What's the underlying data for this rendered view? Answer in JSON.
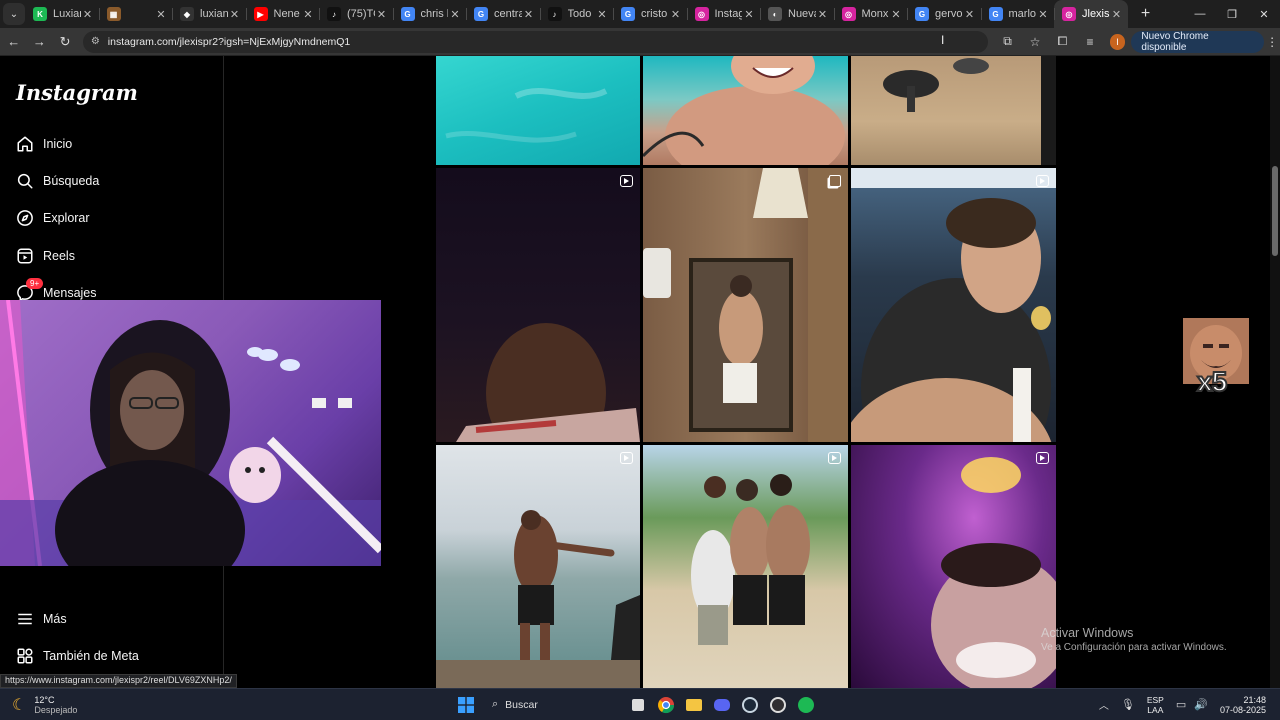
{
  "browser": {
    "tabs": [
      {
        "title": "Luxian",
        "favicon_color": "#1db954",
        "favicon_glyph": "K",
        "active": false
      },
      {
        "title": "",
        "favicon_color": "#8a5a2b",
        "favicon_glyph": "▦",
        "active": false
      },
      {
        "title": "luxiani",
        "favicon_color": "#333333",
        "favicon_glyph": "◆",
        "active": false
      },
      {
        "title": "Nene d",
        "favicon_color": "#ff0000",
        "favicon_glyph": "▶",
        "active": false
      },
      {
        "title": "(75)TOI",
        "favicon_color": "#111111",
        "favicon_glyph": "♪",
        "active": false
      },
      {
        "title": "chris h",
        "favicon_color": "#4285f4",
        "favicon_glyph": "G",
        "active": false
      },
      {
        "title": "central",
        "favicon_color": "#4285f4",
        "favicon_glyph": "G",
        "active": false
      },
      {
        "title": "Todo ki",
        "favicon_color": "#111111",
        "favicon_glyph": "♪",
        "active": false
      },
      {
        "title": "cristo r",
        "favicon_color": "#4285f4",
        "favicon_glyph": "G",
        "active": false
      },
      {
        "title": "Instagr",
        "favicon_color": "#d6249f",
        "favicon_glyph": "◎",
        "active": false
      },
      {
        "title": "Nueva",
        "favicon_color": "#555555",
        "favicon_glyph": "◐",
        "active": false
      },
      {
        "title": "Monxi",
        "favicon_color": "#d6249f",
        "favicon_glyph": "◎",
        "active": false
      },
      {
        "title": "gervon",
        "favicon_color": "#4285f4",
        "favicon_glyph": "G",
        "active": false
      },
      {
        "title": "marlon",
        "favicon_color": "#4285f4",
        "favicon_glyph": "G",
        "active": false
      },
      {
        "title": "Jlexispr",
        "favicon_color": "#d6249f",
        "favicon_glyph": "◎",
        "active": true
      }
    ],
    "url": "instagram.com/jlexispr2?igsh=NjExMjgyNmdnemQ1",
    "update_chip": "Nuevo Chrome disponible",
    "profile_initial": "I",
    "status_url": "https://www.instagram.com/jlexispr2/reel/DLV69ZXNHp2/"
  },
  "sidebar": {
    "logo": "Instagram",
    "items": [
      {
        "label": "Inicio",
        "icon": "home-icon"
      },
      {
        "label": "Búsqueda",
        "icon": "search-icon"
      },
      {
        "label": "Explorar",
        "icon": "compass-icon"
      },
      {
        "label": "Reels",
        "icon": "reels-icon"
      },
      {
        "label": "Mensajes",
        "icon": "messenger-icon",
        "badge": "9+"
      }
    ],
    "bottom_items": [
      {
        "label": "Más",
        "icon": "menu-icon"
      },
      {
        "label": "También de Meta",
        "icon": "meta-icon"
      }
    ]
  },
  "grid": {
    "posts": [
      {
        "type": "none",
        "scene": "turquoise sea water"
      },
      {
        "type": "none",
        "scene": "smiling shirtless man in water"
      },
      {
        "type": "none",
        "scene": "barbershop floor"
      },
      {
        "type": "reel",
        "scene": "man in dark room"
      },
      {
        "type": "carousel",
        "scene": "mirror selfie in bathroom"
      },
      {
        "type": "reel",
        "scene": "man eating at restaurant"
      },
      {
        "type": "reel",
        "scene": "man on dock by sea"
      },
      {
        "type": "reel",
        "scene": "group of friends at beach"
      },
      {
        "type": "reel",
        "scene": "purple lit party"
      }
    ]
  },
  "overlay": {
    "emote_label": "x5"
  },
  "windows_watermark": {
    "title": "Activar Windows",
    "subtitle": "Ve a Configuración para activar Windows."
  },
  "taskbar": {
    "weather_temp": "12°C",
    "weather_desc": "Despejado",
    "search_placeholder": "Buscar",
    "lang_top": "ESP",
    "lang_bottom": "LAA",
    "time": "21:48",
    "date": "07-08-2025"
  }
}
